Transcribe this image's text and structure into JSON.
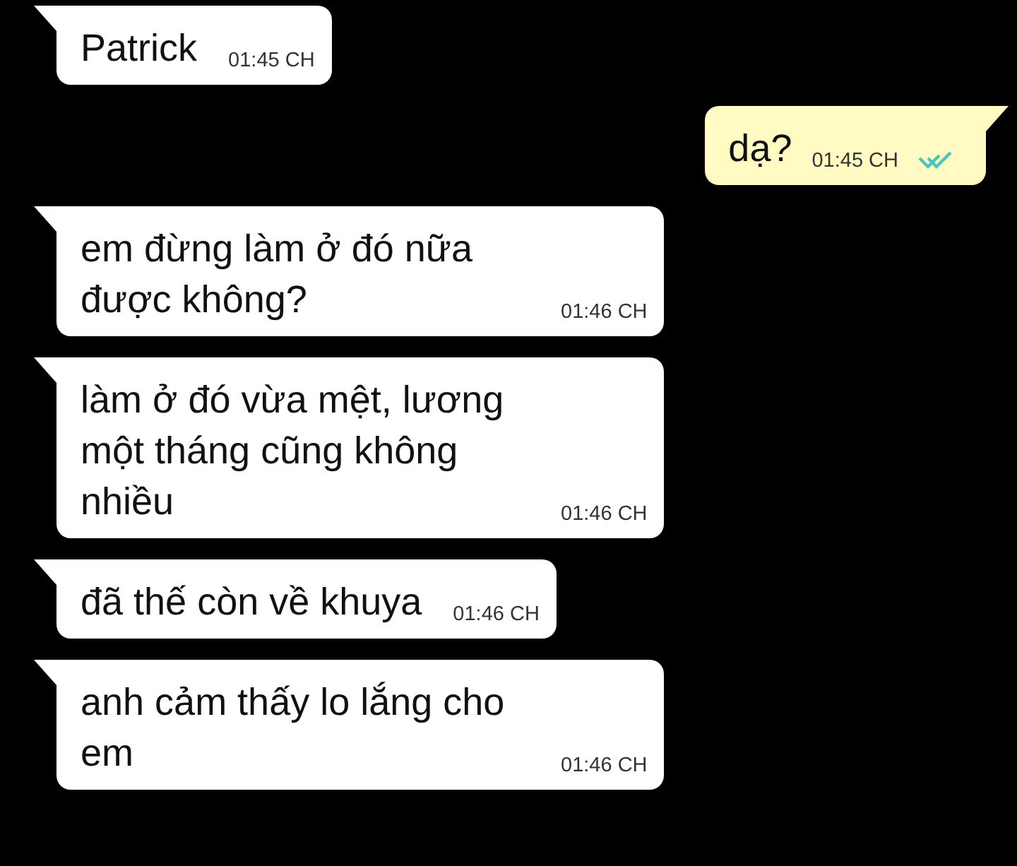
{
  "messages": [
    {
      "kind": "in",
      "text": "Patrick",
      "time": "01:45 CH"
    },
    {
      "kind": "out",
      "text": "dạ?",
      "time": "01:45 CH",
      "read": true
    },
    {
      "kind": "in",
      "text": "em đừng làm ở đó nữa được không?",
      "time": "01:46 CH"
    },
    {
      "kind": "in",
      "text": "làm ở đó vừa mệt, lương một tháng cũng không nhiều",
      "time": "01:46 CH"
    },
    {
      "kind": "in",
      "text": "đã thế còn về khuya",
      "time": "01:46 CH"
    },
    {
      "kind": "in",
      "text": "anh cảm thấy lo lắng cho em",
      "time": "01:46 CH"
    }
  ]
}
